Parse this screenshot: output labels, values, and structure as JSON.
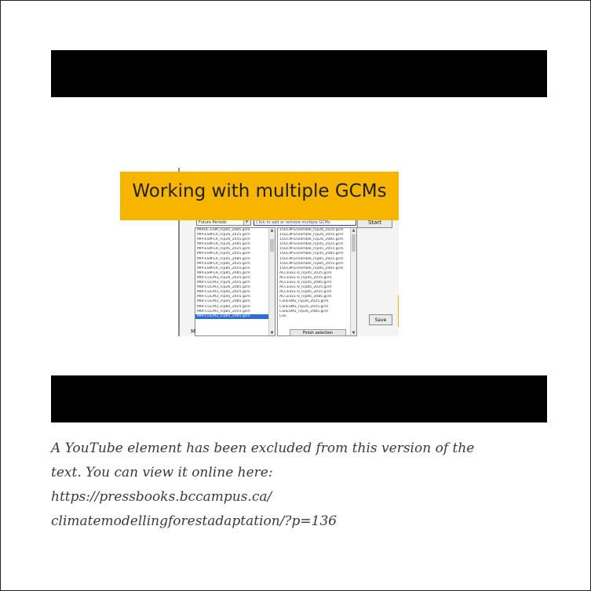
{
  "embed": {
    "thumbnail": {
      "title": "Working with multiple GCMs",
      "banner_color": "#f7b500",
      "dropdown_value": "Future Periods",
      "hint_text": "Click to add or remove multiple GCMs",
      "start_label": "Start",
      "save_label": "Save",
      "finish_label": "Finish selection",
      "stray_text": "M",
      "left_list": [
        "MIROC-ESM_rcp85_2085.gcm",
        "MPI-ESM-LR_rcp26_2025.gcm",
        "MPI-ESM-LR_rcp26_2055.gcm",
        "MPI-ESM-LR_rcp26_2085.gcm",
        "MPI-ESM-LR_rcp45_2025.gcm",
        "MPI-ESM-LR_rcp45_2055.gcm",
        "MPI-ESM-LR_rcp45_2085.gcm",
        "MPI-ESM-LR_rcp85_2025.gcm",
        "MPI-ESM-LR_rcp85_2055.gcm",
        "MPI-ESM-LR_rcp85_2085.gcm",
        "MRI-CGCM3_rcp26_2025.gcm",
        "MRI-CGCM3_rcp26_2055.gcm",
        "MRI-CGCM3_rcp26_2085.gcm",
        "MRI-CGCM3_rcp45_2025.gcm",
        "MRI-CGCM3_rcp45_2055.gcm",
        "MRI-CGCM3_rcp45_2085.gcm",
        "MRI-CGCM3_rcp85_2025.gcm",
        "MRI-CGCM3_rcp85_2055.gcm",
        "MRI-CGCM3_rcp85_2085.gcm"
      ],
      "selected_index": 18,
      "right_list": [
        "15GCM-Ensemble_rcp26_2025.gcm",
        "15GCM-Ensemble_rcp26_2055.gcm",
        "15GCM-Ensemble_rcp26_2085.gcm",
        "15GCM-Ensemble_rcp45_2025.gcm",
        "15GCM-Ensemble_rcp45_2055.gcm",
        "15GCM-Ensemble_rcp45_2085.gcm",
        "15GCM-Ensemble_rcp85_2025.gcm",
        "15GCM-Ensemble_rcp85_2055.gcm",
        "15GCM-Ensemble_rcp85_2085.gcm",
        "ACCESS1-0_rcp45_2025.gcm",
        "ACCESS1-0_rcp45_2055.gcm",
        "ACCESS1-0_rcp45_2085.gcm",
        "ACCESS1-0_rcp85_2025.gcm",
        "ACCESS1-0_rcp85_2055.gcm",
        "ACCESS1-0_rcp85_2085.gcm",
        "CanESM2_rcp26_2025.gcm",
        "CanESM2_rcp26_2055.gcm",
        "CanESM2_rcp26_2085.gcm",
        "Can"
      ]
    }
  },
  "caption": {
    "line1": "A YouTube element has been excluded from this version of the",
    "line2": "text. You can view it online here:",
    "line3": "https://pressbooks.bccampus.ca/",
    "line4": "climatemodellingforestadaptation/?p=136"
  }
}
